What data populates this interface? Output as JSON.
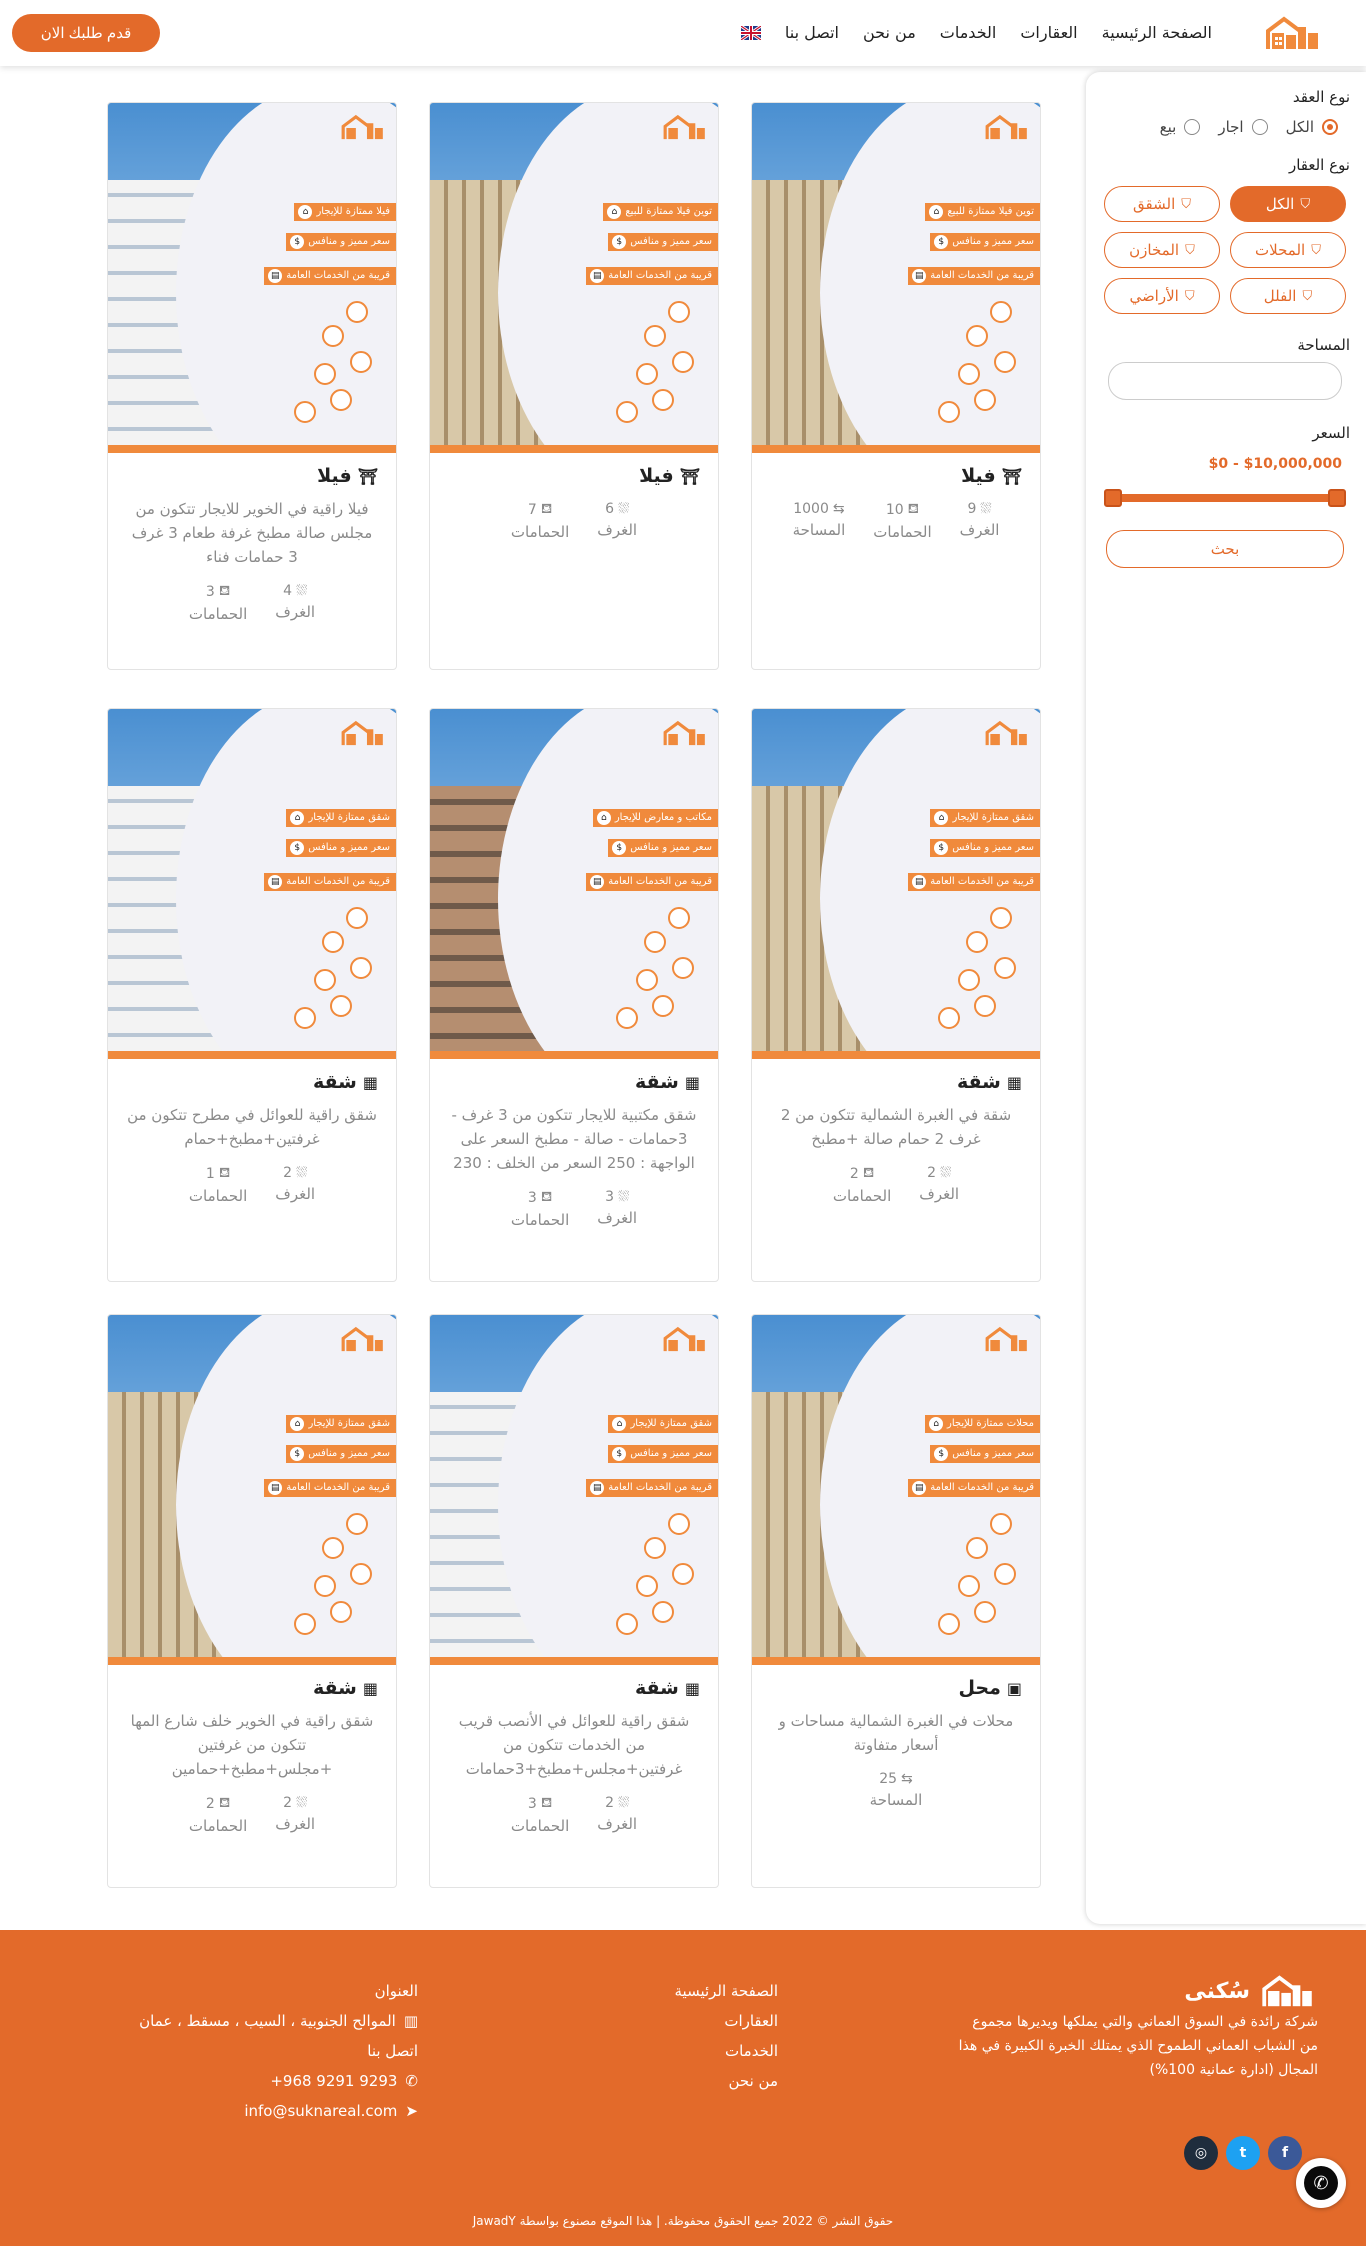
{
  "header": {
    "nav": [
      "الصفحة الرئيسية",
      "العقارات",
      "الخدمات",
      "من نحن",
      "اتصل بنا"
    ],
    "cta": "قدم طلبك الان",
    "brand_color": "#e36a2a"
  },
  "filters": {
    "contract_label": "نوع العقد",
    "contract_options": [
      "الكل",
      "اجار",
      "بيع"
    ],
    "contract_selected": "الكل",
    "property_label": "نوع العقار",
    "property_types": [
      "الكل",
      "الشقق",
      "المحلات",
      "المخازن",
      "الفلل",
      "الأراضي"
    ],
    "property_selected": "الكل",
    "area_label": "المساحة",
    "area_value": "",
    "price_label": "السعر",
    "price_range": "$0 - $10,000,000",
    "search_label": "بحث"
  },
  "cards": [
    {
      "type": "فيلا",
      "icon": "villa-icon",
      "image_tags": [
        "توين فيلا ممتازة للبيع",
        "سعر مميز و منافس",
        "قريبة من الخدمات العامة"
      ],
      "desc": "",
      "stats": [
        {
          "value": "9",
          "label": "الغرف",
          "icon": "bed-icon"
        },
        {
          "value": "10",
          "label": "الحمامات",
          "icon": "bath-icon"
        },
        {
          "value": "1000",
          "label": "المساحة",
          "icon": "area-icon"
        }
      ]
    },
    {
      "type": "فيلا",
      "icon": "villa-icon",
      "image_tags": [
        "توين فيلا ممتازة للبيع",
        "سعر مميز و منافس",
        "قريبة من الخدمات العامة"
      ],
      "desc": "",
      "stats": [
        {
          "value": "6",
          "label": "الغرف",
          "icon": "bed-icon"
        },
        {
          "value": "7",
          "label": "الحمامات",
          "icon": "bath-icon"
        }
      ]
    },
    {
      "type": "فيلا",
      "icon": "villa-icon",
      "image_tags": [
        "فيلا ممتازة للإيجار",
        "سعر مميز و منافس",
        "قريبة من الخدمات العامة"
      ],
      "desc": "فيلا راقية في الخوير للايجار تتكون من مجلس صالة مطبخ غرفة طعام 3 غرف 3 حمامات فناء",
      "stats": [
        {
          "value": "4",
          "label": "الغرف",
          "icon": "bed-icon"
        },
        {
          "value": "3",
          "label": "الحمامات",
          "icon": "bath-icon"
        }
      ]
    },
    {
      "type": "شقة",
      "icon": "building-icon",
      "image_tags": [
        "شقق ممتازة للإيجار",
        "سعر مميز و منافس",
        "قريبة من الخدمات العامة"
      ],
      "desc": "شقة في الغبرة الشمالية تتكون من 2 غرف 2 حمام صالة +مطبخ",
      "stats": [
        {
          "value": "2",
          "label": "الغرف",
          "icon": "bed-icon"
        },
        {
          "value": "2",
          "label": "الحمامات",
          "icon": "bath-icon"
        }
      ]
    },
    {
      "type": "شقة",
      "icon": "building-icon",
      "image_tags": [
        "مكاتب و معارض للإيجار",
        "سعر مميز و منافس",
        "قريبة من الخدمات العامة"
      ],
      "desc": "شقق مكتبية للايجار تتكون من 3 غرف - 3حمامات - صالة - مطبخ السعر على الواجهة : 250 السعر من الخلف : 230",
      "stats": [
        {
          "value": "3",
          "label": "الغرف",
          "icon": "bed-icon"
        },
        {
          "value": "3",
          "label": "الحمامات",
          "icon": "bath-icon"
        }
      ]
    },
    {
      "type": "شقة",
      "icon": "building-icon",
      "image_tags": [
        "شقق ممتازة للإيجار",
        "سعر مميز و منافس",
        "قريبة من الخدمات العامة"
      ],
      "desc": "شقق راقية للعوائل في مطرح تتكون من غرفتين+مطبخ+حمام",
      "stats": [
        {
          "value": "2",
          "label": "الغرف",
          "icon": "bed-icon"
        },
        {
          "value": "1",
          "label": "الحمامات",
          "icon": "bath-icon"
        }
      ]
    },
    {
      "type": "محل",
      "icon": "shop-icon",
      "image_tags": [
        "محلات ممتازة للإيجار",
        "سعر مميز و منافس",
        "قريبة من الخدمات العامة"
      ],
      "desc": "محلات في الغبرة الشمالية مساحات و أسعار متفاوتة",
      "stats": [
        {
          "value": "25",
          "label": "المساحة",
          "icon": "area-icon"
        }
      ]
    },
    {
      "type": "شقة",
      "icon": "building-icon",
      "image_tags": [
        "شقق ممتازة للإيجار",
        "سعر مميز و منافس",
        "قريبة من الخدمات العامة"
      ],
      "desc": "شقق راقية للعوائل في الأنصب قريب من الخدمات تتكون من غرفتين+مجلس+مطبخ+3حمامات",
      "stats": [
        {
          "value": "2",
          "label": "الغرف",
          "icon": "bed-icon"
        },
        {
          "value": "3",
          "label": "الحمامات",
          "icon": "bath-icon"
        }
      ]
    },
    {
      "type": "شقة",
      "icon": "building-icon",
      "image_tags": [
        "شقق ممتازة للإيجار",
        "سعر مميز و منافس",
        "قريبة من الخدمات العامة"
      ],
      "desc": "شقق راقية في الخوير خلف شارع المها تتكون من غرفتين +مجلس+مطبخ+حمامين",
      "stats": [
        {
          "value": "2",
          "label": "الغرف",
          "icon": "bed-icon"
        },
        {
          "value": "2",
          "label": "الحمامات",
          "icon": "bath-icon"
        }
      ]
    }
  ],
  "footer": {
    "brand": "سُكنى",
    "about": "شركة رائدة في السوق العماني والتي يملكها ويديرها مجموع من الشباب العماني الطموح الذي يمتلك الخبرة الكبيرة في هذا المجال (ادارة عمانية 100%)",
    "links": [
      "الصفحة الرئيسية",
      "العقارات",
      "الخدمات",
      "من نحن"
    ],
    "address_label": "العنوان",
    "address": "الموالح الجنوبية ، السيب ، مسقط ، عمان",
    "contact_label": "اتصل بنا",
    "phone": "+968 9291 9293",
    "email": "info@suknareal.com",
    "copyright": "حقوق النشر © 2022 جميع الحقوق محفوظة. | هذا الموقع مصنوع بواسطة JawadY"
  }
}
